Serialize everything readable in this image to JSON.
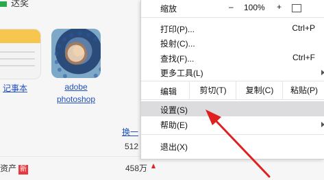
{
  "background": {
    "top_label": "达奖",
    "apps": [
      {
        "label": "记事本"
      },
      {
        "label_line1": "adobe",
        "label_line2": "photoshop"
      }
    ],
    "swap_link": "换一",
    "value_512": "512",
    "row_label": "资产",
    "new_badge": "新",
    "value_458": "458万"
  },
  "menu": {
    "zoom": {
      "label": "缩放",
      "minus": "–",
      "value": "100%",
      "plus": "+"
    },
    "items": [
      {
        "label": "打印(P)...",
        "shortcut": "Ctrl+P"
      },
      {
        "label": "投射(C)..."
      },
      {
        "label": "查找(F)...",
        "shortcut": "Ctrl+F"
      },
      {
        "label": "更多工具(L)"
      },
      {
        "label": "设置(S)"
      },
      {
        "label": "帮助(E)"
      },
      {
        "label": "退出(X)"
      }
    ],
    "edit": {
      "label": "编辑",
      "cut": "剪切(T)",
      "copy": "复制(C)",
      "paste": "粘贴(P)"
    }
  },
  "colors": {
    "annotation_arrow": "#e02020",
    "hover_row": "#dcdcdf",
    "link": "#1f4fbf"
  }
}
